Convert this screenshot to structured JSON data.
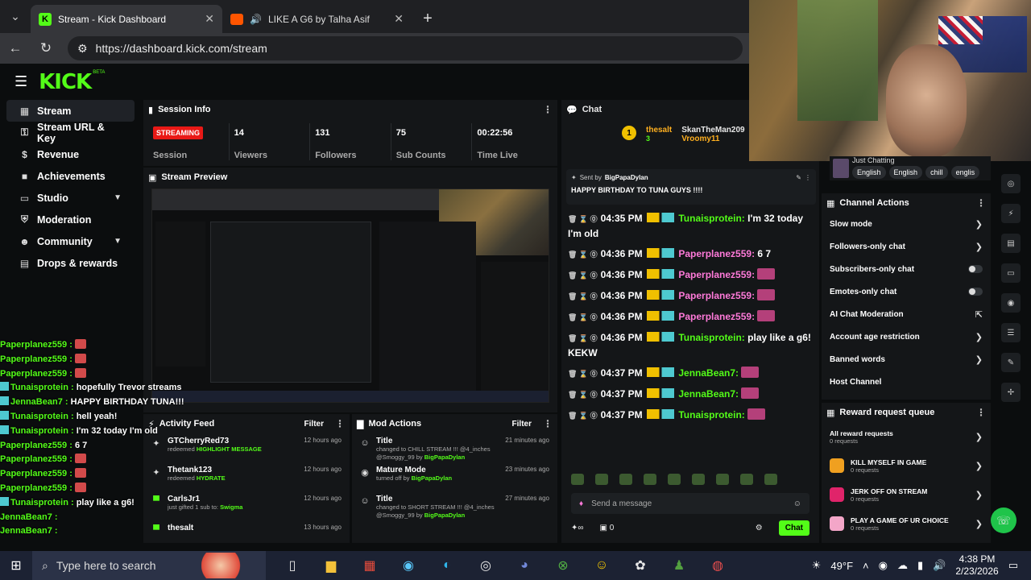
{
  "browser": {
    "tabs": [
      {
        "title": "Stream - Kick Dashboard",
        "active": true
      },
      {
        "title": "LIKE A G6 by Talha Asif",
        "active": false
      }
    ],
    "url": "https://dashboard.kick.com/stream"
  },
  "kick": {
    "logo": "KICK",
    "beta": "BETA"
  },
  "sidebar": {
    "items": [
      {
        "label": "Stream",
        "icon": "stream-icon",
        "active": true
      },
      {
        "label": "Stream URL & Key",
        "icon": "key-icon"
      },
      {
        "label": "Revenue",
        "icon": "dollar-icon"
      },
      {
        "label": "Achievements",
        "icon": "trophy-icon"
      },
      {
        "label": "Studio",
        "icon": "studio-icon",
        "expandable": true
      },
      {
        "label": "Moderation",
        "icon": "shield-icon"
      },
      {
        "label": "Community",
        "icon": "community-icon",
        "expandable": true
      },
      {
        "label": "Drops & rewards",
        "icon": "gift-icon"
      }
    ]
  },
  "session": {
    "title": "Session Info",
    "status": "STREAMING",
    "status_label": "Session",
    "stats": [
      {
        "value": "14",
        "label": "Viewers"
      },
      {
        "value": "131",
        "label": "Followers"
      },
      {
        "value": "75",
        "label": "Sub Counts"
      },
      {
        "value": "00:22:56",
        "label": "Time Live"
      }
    ]
  },
  "preview": {
    "title": "Stream Preview"
  },
  "activity": {
    "title": "Activity Feed",
    "filter": "Filter",
    "items": [
      {
        "name": "GTCherryRed73",
        "sub_pre": "redeemed",
        "sub_hl": "HIGHLIGHT MESSAGE",
        "time": "12 hours ago"
      },
      {
        "name": "Thetank123",
        "sub_pre": "redeemed",
        "sub_hl": "HYDRATE",
        "time": "12 hours ago"
      },
      {
        "name": "CarlsJr1",
        "sub_pre": "just gifted 1 sub to:",
        "sub_hl": "Swigma",
        "time": "12 hours ago"
      },
      {
        "name": "thesalt",
        "sub_pre": "",
        "sub_hl": "",
        "time": "13 hours ago"
      }
    ]
  },
  "mod_actions": {
    "title": "Mod Actions",
    "filter": "Filter",
    "items": [
      {
        "title": "Title",
        "line1": "changed to CHILL STREAM !!! @4_inches @Smoggy_99 by",
        "by": "BigPapaDylan",
        "time": "21 minutes ago"
      },
      {
        "title": "Mature Mode",
        "line1": "turned off by",
        "by": "BigPapaDylan",
        "time": "23 minutes ago"
      },
      {
        "title": "Title",
        "line1": "changed to SHORT STREAM !!! @4_inches @Smoggy_99 by",
        "by": "BigPapaDylan",
        "time": "27 minutes ago"
      }
    ]
  },
  "chat": {
    "title": "Chat",
    "gifters": [
      {
        "name": "thesalt",
        "count": "3"
      },
      {
        "name": "SkanTheMan209"
      },
      {
        "name": "Vroomy11"
      }
    ],
    "gift_rank": "1",
    "pinned": {
      "sent_by": "Sent by",
      "user": "BigPapaDylan",
      "message": "HAPPY BIRTHDAY TO TUNA GUYS !!!!"
    },
    "messages": [
      {
        "time": "04:35 PM",
        "user": "Tunaisprotein:",
        "text": "I'm 32 today I'm old"
      },
      {
        "time": "04:36 PM",
        "user": "Paperplanez559:",
        "text": "6 7"
      },
      {
        "time": "04:36 PM",
        "user": "Paperplanez559:",
        "text": ""
      },
      {
        "time": "04:36 PM",
        "user": "Paperplanez559:",
        "text": ""
      },
      {
        "time": "04:36 PM",
        "user": "Paperplanez559:",
        "text": ""
      },
      {
        "time": "04:36 PM",
        "user": "Tunaisprotein:",
        "text": "play like a g6! KEKW"
      },
      {
        "time": "04:37 PM",
        "user": "JennaBean7:",
        "text": ""
      },
      {
        "time": "04:37 PM",
        "user": "JennaBean7:",
        "text": ""
      },
      {
        "time": "04:37 PM",
        "user": "Tunaisprotein:",
        "text": ""
      }
    ],
    "input_placeholder": "Send a message",
    "points": "0",
    "send_label": "Chat"
  },
  "category": {
    "label": "Just Chatting",
    "tags": [
      "English",
      "English",
      "chill",
      "englis"
    ]
  },
  "channel_actions": {
    "title": "Channel Actions",
    "items": [
      {
        "label": "Slow mode",
        "control": "chevron"
      },
      {
        "label": "Followers-only chat",
        "control": "chevron"
      },
      {
        "label": "Subscribers-only chat",
        "control": "toggle"
      },
      {
        "label": "Emotes-only chat",
        "control": "toggle"
      },
      {
        "label": "AI Chat Moderation",
        "control": "external"
      },
      {
        "label": "Account age restriction",
        "control": "chevron"
      },
      {
        "label": "Banned words",
        "control": "chevron"
      },
      {
        "label": "Host Channel",
        "control": "none"
      }
    ]
  },
  "reward_queue": {
    "title": "Reward request queue",
    "items": [
      {
        "name": "All reward requests",
        "count": "0 requests",
        "color": "none"
      },
      {
        "name": "KILL MYSELF IN GAME",
        "count": "0 requests",
        "color": "#f0a020"
      },
      {
        "name": "JERK OFF ON STREAM",
        "count": "0 requests",
        "color": "#e0246a"
      },
      {
        "name": "PLAY A GAME OF UR CHOICE",
        "count": "0 requests",
        "color": "#f3a6c8"
      }
    ]
  },
  "overlay_chat": [
    {
      "user": "Paperplanez559 :",
      "text": ""
    },
    {
      "user": "Paperplanez559 :",
      "text": ""
    },
    {
      "user": "Paperplanez559 :",
      "text": ""
    },
    {
      "user": "Tunaisprotein :",
      "text": "hopefully Trevor streams"
    },
    {
      "user": "JennaBean7 :",
      "text": "HAPPY BIRTHDAY TUNA!!!"
    },
    {
      "user": "Tunaisprotein :",
      "text": "hell yeah!"
    },
    {
      "user": "Tunaisprotein :",
      "text": "I'm 32 today I'm old"
    },
    {
      "user": "Paperplanez559 :",
      "text": "6 7"
    },
    {
      "user": "Paperplanez559 :",
      "text": ""
    },
    {
      "user": "Paperplanez559 :",
      "text": ""
    },
    {
      "user": "Paperplanez559 :",
      "text": ""
    },
    {
      "user": "Tunaisprotein :",
      "text": "play like a g6!"
    },
    {
      "user": "JennaBean7 :",
      "text": ""
    },
    {
      "user": "JennaBean7 :",
      "text": ""
    }
  ],
  "taskbar": {
    "search_placeholder": "Type here to search",
    "weather": "49°F",
    "time": "4:38 PM",
    "date": "2/23/2026"
  },
  "colors": {
    "accent": "#53fc18",
    "live": "#e91916"
  }
}
